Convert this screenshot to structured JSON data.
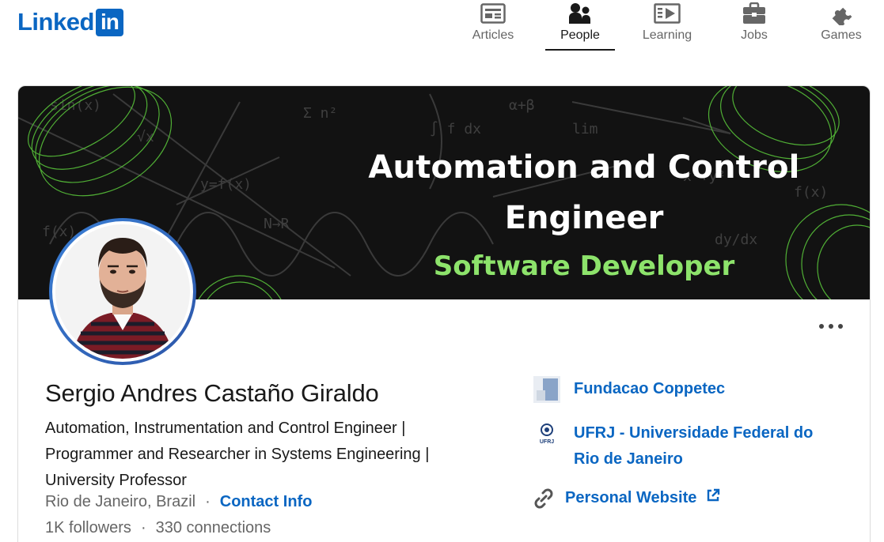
{
  "header": {
    "logo_word": "Linked",
    "logo_box": "in",
    "nav": [
      {
        "label": "Articles",
        "icon": "articles-icon",
        "active": false
      },
      {
        "label": "People",
        "icon": "people-icon",
        "active": true
      },
      {
        "label": "Learning",
        "icon": "learning-icon",
        "active": false
      },
      {
        "label": "Jobs",
        "icon": "jobs-icon",
        "active": false
      },
      {
        "label": "Games",
        "icon": "games-icon",
        "active": false
      }
    ]
  },
  "banner": {
    "line1": "Automation and Control",
    "line2": "Engineer",
    "line3": "Software Developer"
  },
  "profile": {
    "name": "Sergio Andres Castaño Giraldo",
    "headline": "Automation, Instrumentation and Control Engineer | Programmer and Researcher in Systems Engineering | University Professor",
    "location": "Rio de Janeiro, Brazil",
    "separator": "·",
    "contact_label": "Contact Info",
    "followers": "1K followers",
    "connections": "330 connections"
  },
  "orgs": [
    {
      "label": "Fundacao Coppetec",
      "icon": "coppetec-logo"
    },
    {
      "label": "UFRJ - Universidade Federal do Rio de Janeiro",
      "icon": "ufrj-logo",
      "logo_text": "UFRJ"
    },
    {
      "label": "Personal Website",
      "icon": "link-icon"
    }
  ],
  "colors": {
    "brand": "#0a66c2",
    "banner_bg": "#121212",
    "banner_accent": "#8de36b"
  }
}
